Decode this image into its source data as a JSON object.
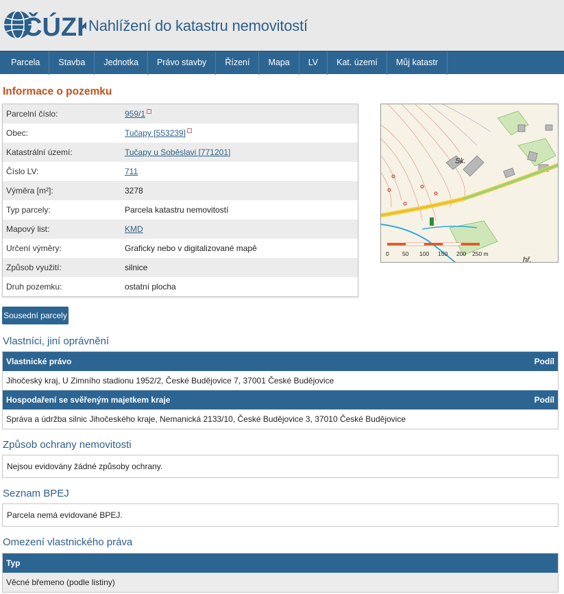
{
  "header": {
    "logo_text": "ČÚZK",
    "title": "Nahlížení do katastru nemovitostí"
  },
  "nav": {
    "items": [
      "Parcela",
      "Stavba",
      "Jednotka",
      "Právo stavby",
      "Řízení",
      "Mapa",
      "LV",
      "Kat. území",
      "Můj katastr"
    ]
  },
  "parcel_info": {
    "title": "Informace o pozemku",
    "rows": [
      {
        "label": "Parcelní číslo:",
        "value": "959/1"
      },
      {
        "label": "Obec:",
        "value": "Tučapy [553239]"
      },
      {
        "label": "Katastrální území:",
        "value": "Tučapy u Soběslavi [771201]"
      },
      {
        "label": "Číslo LV:",
        "value": "711"
      },
      {
        "label": "Výměra [m²]:",
        "value": "3278"
      },
      {
        "label": "Typ parcely:",
        "value": "Parcela katastru nemovitostí"
      },
      {
        "label": "Mapový list:",
        "value": "KMD"
      },
      {
        "label": "Určení výměry:",
        "value": "Graficky nebo v digitalizované mapě"
      },
      {
        "label": "Způsob využití:",
        "value": "silnice"
      },
      {
        "label": "Druh pozemku:",
        "value": "ostatní plocha"
      }
    ]
  },
  "map": {
    "scale_labels": [
      "0",
      "50",
      "100",
      "150",
      "200",
      "250 m"
    ],
    "labels": {
      "sk": "Sk.",
      "hr": "hř."
    }
  },
  "buttons": {
    "neighbors": "Sousední parcely"
  },
  "owners": {
    "title": "Vlastníci, jiní oprávnění",
    "groups": [
      {
        "header": "Vlastnické právo",
        "share_header": "Podíl",
        "entry": "Jihočeský kraj, U Zimního stadionu 1952/2, České Budějovice 7, 37001 České Budějovice"
      },
      {
        "header": "Hospodaření se svěřeným majetkem kraje",
        "share_header": "Podíl",
        "entry": "Správa a údržba silnic Jihočeského kraje, Nemanická 2133/10, České Budějovice 3, 37010 České Budějovice"
      }
    ]
  },
  "protection": {
    "title": "Způsob ochrany nemovitosti",
    "text": "Nejsou evidovány žádné způsoby ochrany."
  },
  "bpej": {
    "title": "Seznam BPEJ",
    "text": "Parcela nemá evidované BPEJ."
  },
  "restrictions": {
    "title": "Omezení vlastnického práva",
    "header": "Typ",
    "rows": [
      "Věcné břemeno (podle listiny)"
    ]
  },
  "colors": {
    "nav_bg": "#2d6592",
    "title_accent": "#c2511b",
    "section_title": "#2c5f8a"
  }
}
